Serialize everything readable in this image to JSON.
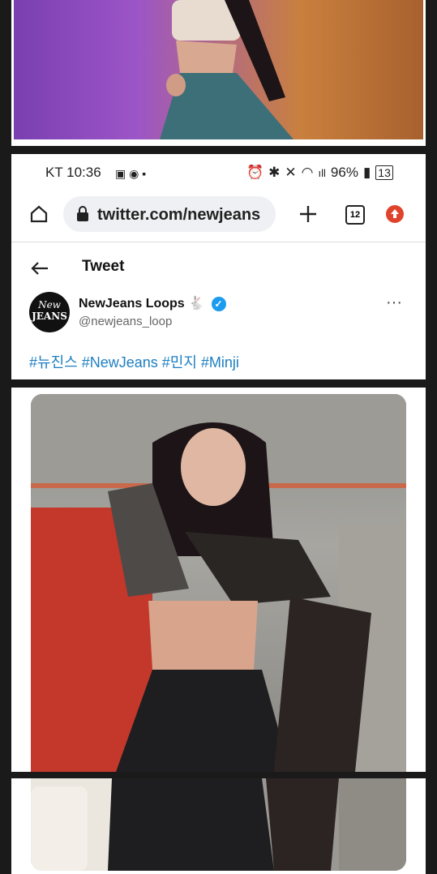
{
  "status_bar": {
    "carrier_time": "KT 10:36",
    "battery": "96%",
    "tab_count": "13"
  },
  "browser": {
    "url": "twitter.com/newjeans",
    "tab_count": "12"
  },
  "tweet": {
    "header_title": "Tweet",
    "author_name": "NewJeans Loops",
    "author_handle": "@newjeans_loop",
    "avatar_text_line1": "New",
    "avatar_text_line2": "JEANS",
    "hashtags": "#뉴진스 #NewJeans #민지 #Minji"
  },
  "colors": {
    "accent_blue": "#1d9bf0",
    "hashtag_blue": "#1d7fc1",
    "record_red": "#e0432b"
  }
}
